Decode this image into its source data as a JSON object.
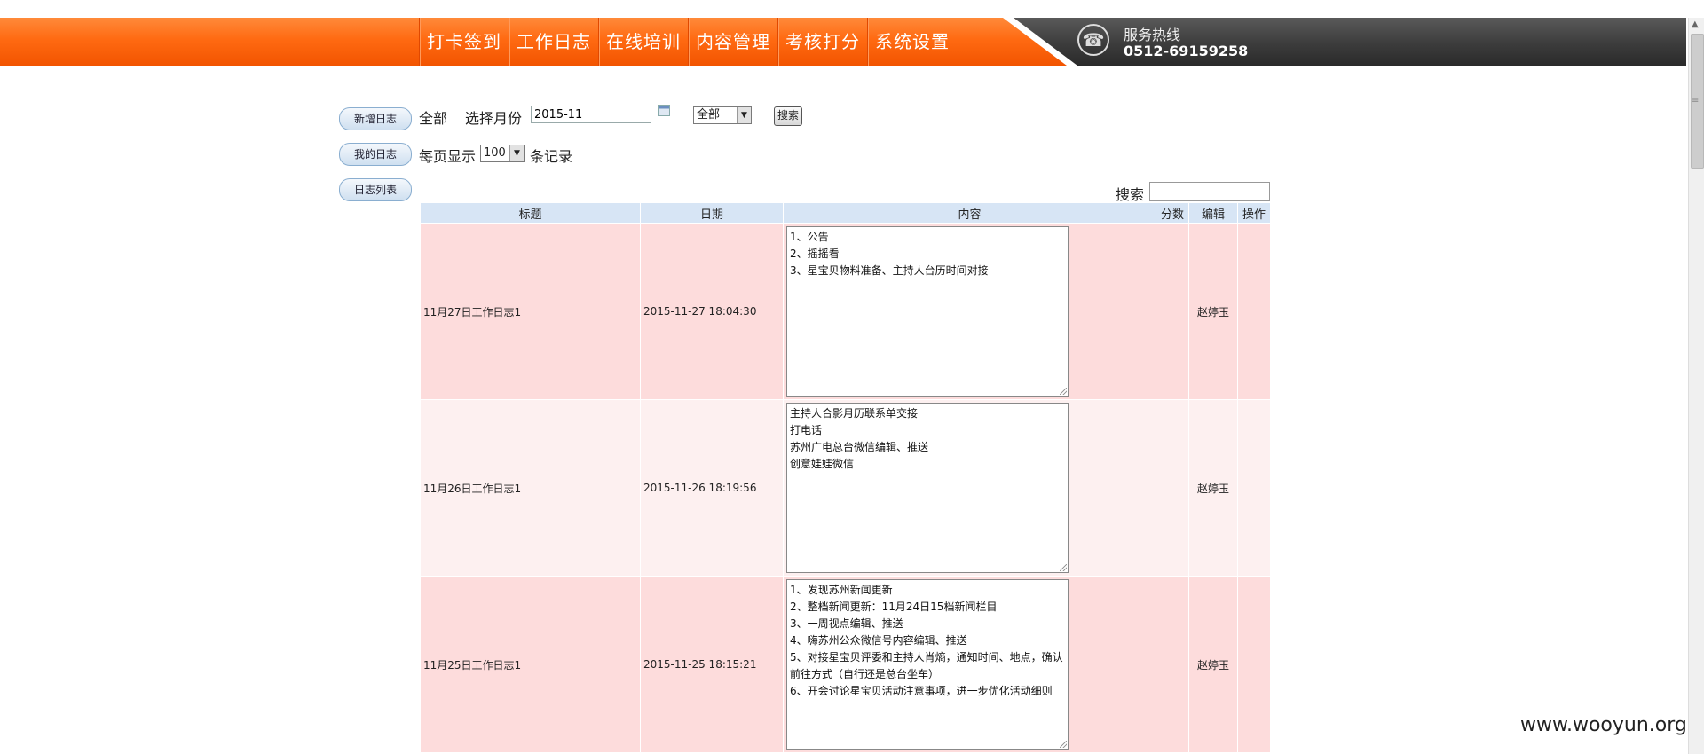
{
  "nav": {
    "items": [
      "打卡签到",
      "工作日志",
      "在线培训",
      "内容管理",
      "考核打分",
      "系统设置"
    ]
  },
  "hotline": {
    "label": "服务热线",
    "number": "0512-69159258",
    "icon": "phone-icon"
  },
  "sidebar": {
    "buttons": [
      "新增日志",
      "我的日志",
      "日志列表"
    ]
  },
  "filters": {
    "all_label": "全部",
    "month_label": "选择月份",
    "month_value": "2015-11",
    "status_select": "全部",
    "search_button": "搜索",
    "per_page_label": "每页显示",
    "per_page_value": "100",
    "per_page_suffix": "条记录"
  },
  "table_search": {
    "label": "搜索",
    "value": ""
  },
  "table": {
    "headers": [
      "标题",
      "日期",
      "内容",
      "分数",
      "编辑",
      "操作"
    ],
    "rows": [
      {
        "title": "11月27日工作日志1",
        "date": "2015-11-27 18:04:30",
        "content": "1、公告\n2、摇摇看\n3、星宝贝物料准备、主持人台历时间对接",
        "score": "",
        "editor": "赵婷玉",
        "action": ""
      },
      {
        "title": "11月26日工作日志1",
        "date": "2015-11-26 18:19:56",
        "content": "主持人合影月历联系单交接\n打电话\n苏州广电总台微信编辑、推送\n创意娃娃微信",
        "score": "",
        "editor": "赵婷玉",
        "action": ""
      },
      {
        "title": "11月25日工作日志1",
        "date": "2015-11-25 18:15:21",
        "content": "1、发现苏州新闻更新\n2、整档新闻更新：11月24日15档新闻栏目\n3、一周视点编辑、推送\n4、嗨苏州公众微信号内容编辑、推送\n5、对接星宝贝评委和主持人肖熵，通知时间、地点，确认前往方式（自行还是总台坐车）\n6、开会讨论星宝贝活动注意事项，进一步优化活动细则",
        "score": "",
        "editor": "赵婷玉",
        "action": ""
      }
    ]
  },
  "watermark": "www.wooyun.org"
}
